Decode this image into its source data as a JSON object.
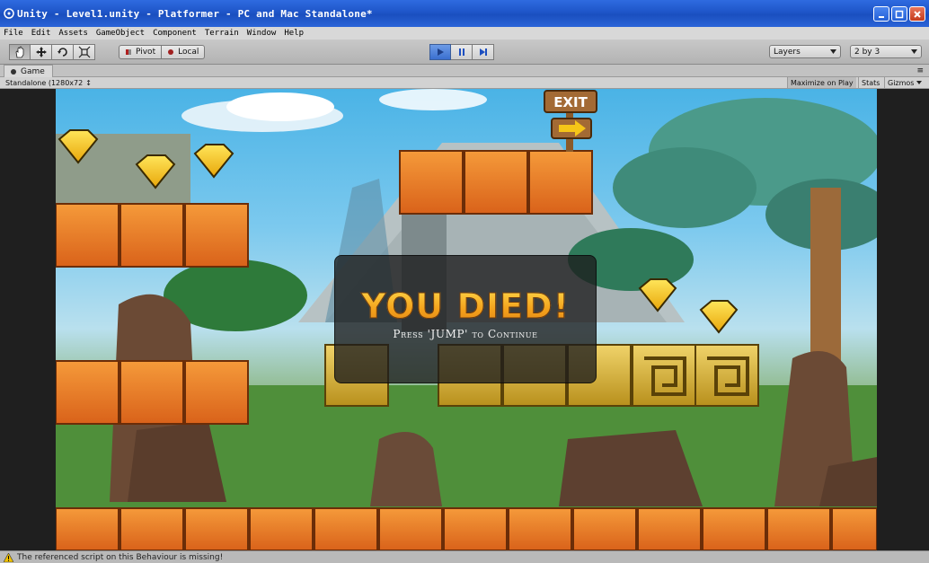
{
  "window": {
    "title": "Unity - Level1.unity - Platformer - PC and Mac Standalone*"
  },
  "menu": [
    "File",
    "Edit",
    "Assets",
    "GameObject",
    "Component",
    "Terrain",
    "Window",
    "Help"
  ],
  "toolbar": {
    "transform_tools": [
      "hand-icon",
      "move-icon",
      "rotate-icon",
      "scale-icon"
    ],
    "pivot_label": "Pivot",
    "local_label": "Local",
    "play_controls": [
      "play-icon",
      "pause-icon",
      "step-icon"
    ],
    "layers_label": "Layers",
    "layout_label": "2 by 3"
  },
  "game_panel": {
    "tab_label": "Game",
    "aspect_label": "Standalone (1280x72",
    "maximize_label": "Maximize on Play",
    "stats_label": "Stats",
    "gizmos_label": "Gizmos"
  },
  "game": {
    "died_title": "YOU DIED!",
    "died_subtitle": "Press 'JUMP' to Continue",
    "exit_sign": "EXIT"
  },
  "status": {
    "message": "The referenced script on this Behaviour is missing!"
  },
  "colors": {
    "titlebar": "#1e55c8",
    "play_active": "#3a6fd0",
    "brick": "#e8731f",
    "gem": "#f5c518",
    "gold_block": "#d9b52a"
  }
}
